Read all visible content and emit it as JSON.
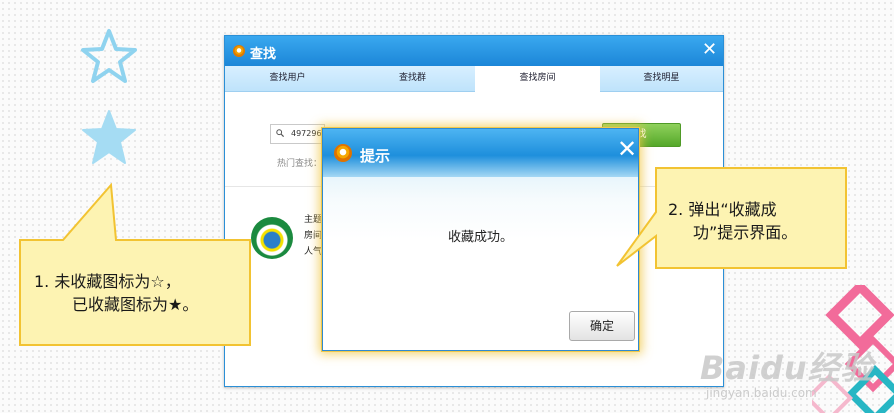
{
  "find_window": {
    "title": "查找",
    "close_glyph": "✕",
    "tabs": [
      {
        "label": "查找用户",
        "active": false
      },
      {
        "label": "查找群",
        "active": false
      },
      {
        "label": "查找房间",
        "active": true
      },
      {
        "label": "查找明星",
        "active": false
      }
    ],
    "search_value": "497296",
    "hot_search_label": "热门查找：",
    "search_button_label": "找",
    "room_lines": [
      "主题",
      "房间",
      "人气"
    ]
  },
  "dialog": {
    "title": "提示",
    "close_glyph": "✕",
    "message": "收藏成功。",
    "ok_label": "确定"
  },
  "callouts": {
    "left_line1": "1.   未收藏图标为☆，",
    "left_line2": "已收藏图标为★。",
    "right_line1": "2.   弹出“收藏成",
    "right_line2": "功”提示界面。"
  },
  "watermark": {
    "main": "Baidu经验",
    "sub": "jingyan.baidu.com"
  },
  "colors": {
    "titlebar_blue": "#1c86d8",
    "callout_fill": "#fdf3b2",
    "callout_border": "#f2c332",
    "star_outline": "#8fd3ef",
    "star_filled": "#a5dcf3",
    "diamond_pink": "#f26b9a",
    "diamond_teal": "#27b6c4"
  },
  "icons": [
    "star-outline-icon",
    "star-filled-icon",
    "qq-logo-icon",
    "search-icon",
    "close-icon"
  ]
}
